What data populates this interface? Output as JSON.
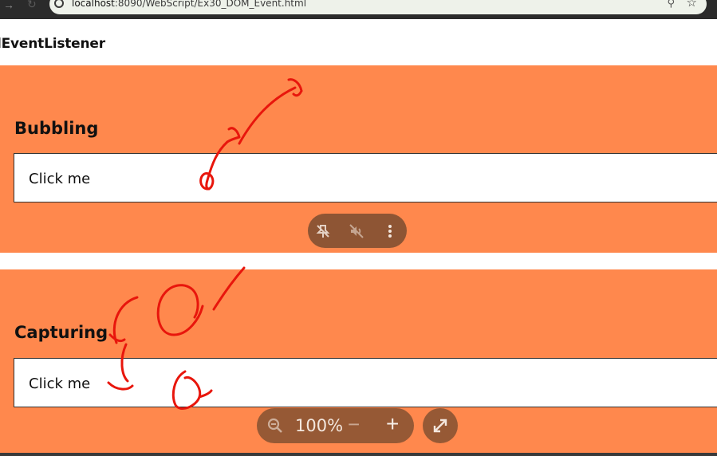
{
  "browser": {
    "url_host": "localhost",
    "url_rest": ":8090/WebScript/Ex30_DOM_Event.html"
  },
  "page": {
    "title": "lEventListener"
  },
  "sections": [
    {
      "heading": "Bubbling",
      "button_label": "Click me"
    },
    {
      "heading": "Capturing",
      "button_label": "Click me"
    }
  ],
  "zoom": {
    "level": "100%",
    "minus": "−",
    "plus": "+"
  },
  "icons": {
    "back": "arrow-back-icon",
    "reload": "reload-icon",
    "info": "info-icon",
    "zoom": "magnifier-icon",
    "star": "star-icon",
    "unpin": "unpin-icon",
    "mute": "mute-icon",
    "more": "more-vertical-icon",
    "zoom_out": "zoom-out-icon",
    "fullscreen": "fullscreen-icon"
  },
  "colors": {
    "section_bg": "#ff884d",
    "annotation": "#e8160c"
  }
}
